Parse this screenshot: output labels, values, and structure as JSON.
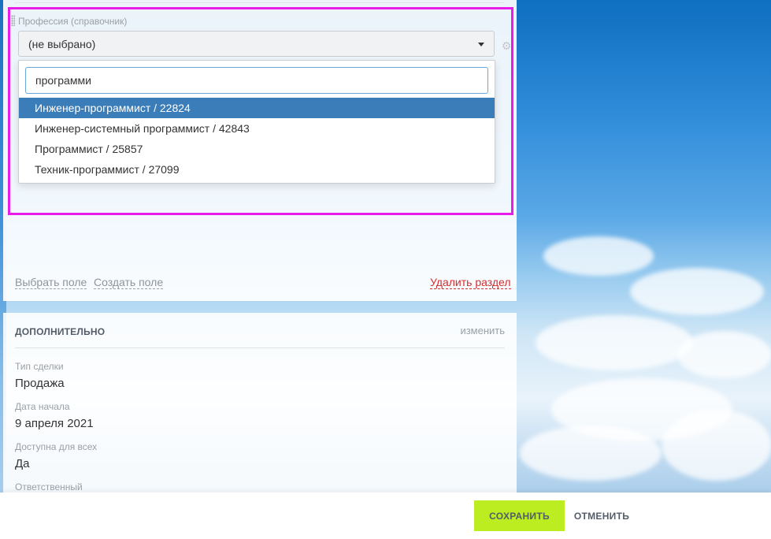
{
  "profession_field": {
    "label": "Профессия (справочник)",
    "selected": "(не выбрано)",
    "search_value": "программи",
    "options": [
      {
        "label": "Инженер-программист / 22824",
        "highlighted": true
      },
      {
        "label": "Инженер-системный программист / 42843",
        "highlighted": false
      },
      {
        "label": "Программист / 25857",
        "highlighted": false
      },
      {
        "label": "Техник-программист / 27099",
        "highlighted": false
      }
    ]
  },
  "section_actions": {
    "choose_field": "Выбрать поле",
    "create_field": "Создать поле",
    "delete_section": "Удалить раздел"
  },
  "additional": {
    "title": "ДОПОЛНИТЕЛЬНО",
    "change": "изменить",
    "fields": [
      {
        "label": "Тип сделки",
        "value": "Продажа"
      },
      {
        "label": "Дата начала",
        "value": "9 апреля 2021"
      },
      {
        "label": "Доступна для всех",
        "value": "Да"
      },
      {
        "label": "Ответственный",
        "value": ""
      }
    ]
  },
  "footer": {
    "save": "СОХРАНИТЬ",
    "cancel": "ОТМЕНИТЬ"
  },
  "colors": {
    "highlight_border": "#e81ce8",
    "option_active_bg": "#3b7db8",
    "save_button": "#bbed21",
    "delete_link": "#d22e2e"
  },
  "icons": {
    "select_caret": "chevron-down-icon",
    "field_settings": "gear-icon",
    "drag": "drag-handle-icon"
  }
}
